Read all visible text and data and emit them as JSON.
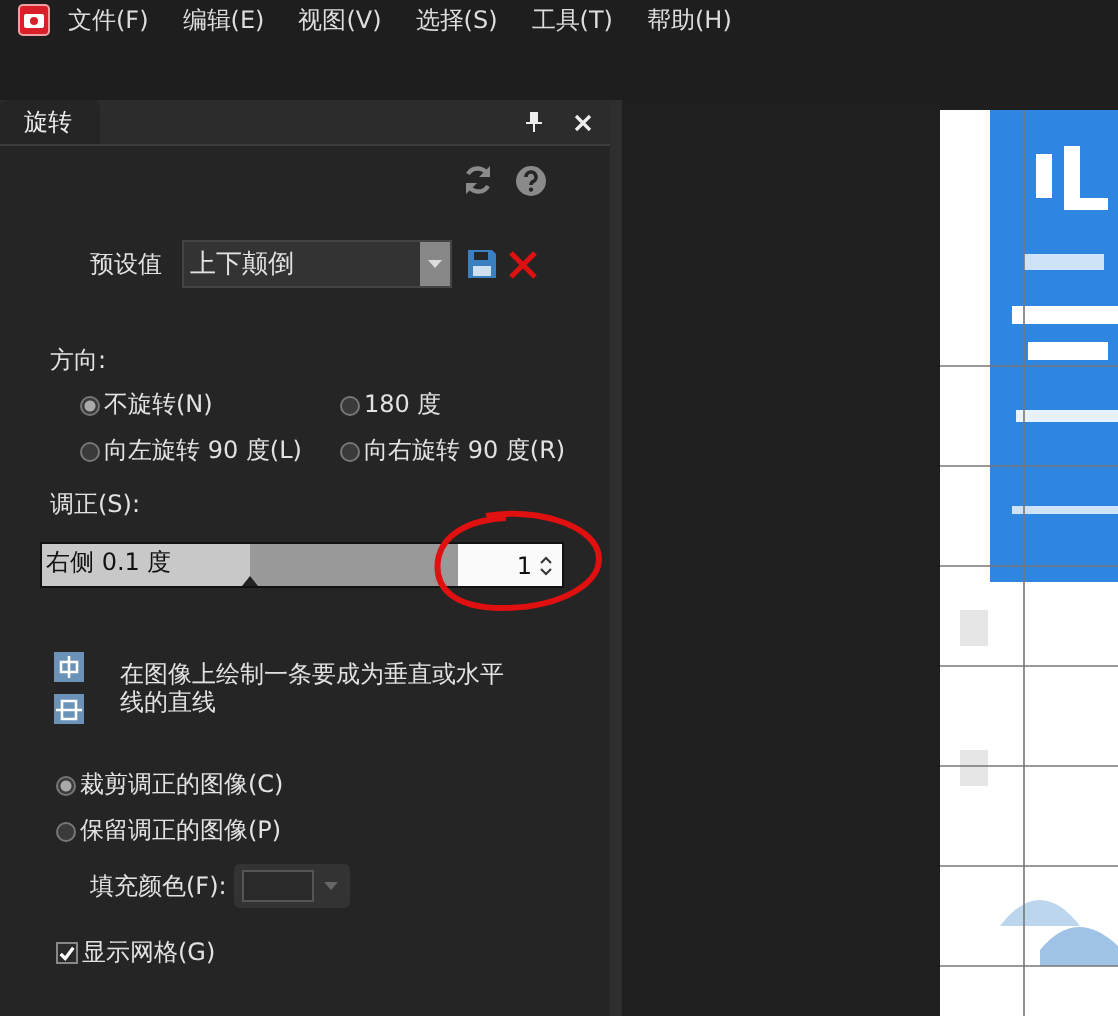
{
  "menu": [
    "文件(F)",
    "编辑(E)",
    "视图(V)",
    "选择(S)",
    "工具(T)",
    "帮助(H)"
  ],
  "panel": {
    "tab": {
      "label": "旋转",
      "selected": true
    },
    "preset": {
      "label": "预设值",
      "value": "上下颠倒"
    },
    "direction": {
      "label": "方向:",
      "options": [
        {
          "label": "不旋转(N)",
          "selected": true
        },
        {
          "label": "180 度",
          "selected": false
        },
        {
          "label": "向左旋转 90 度(L)",
          "selected": false
        },
        {
          "label": "向右旋转 90 度(R)",
          "selected": false
        }
      ]
    },
    "straighten": {
      "label": "调正(S):",
      "slider_text": "右侧 0.1 度",
      "level": 0.5,
      "value": "1"
    },
    "hint": "在图像上绘制一条要成为垂直或水平线的直线",
    "crop_options": [
      {
        "label": "裁剪调正的图像(C)",
        "selected": true
      },
      {
        "label": "保留调正的图像(P)",
        "selected": false
      }
    ],
    "fill_color": {
      "label": "填充颜色(F):"
    },
    "show_grid": {
      "label": "显示网格(G)",
      "checked": true
    }
  }
}
